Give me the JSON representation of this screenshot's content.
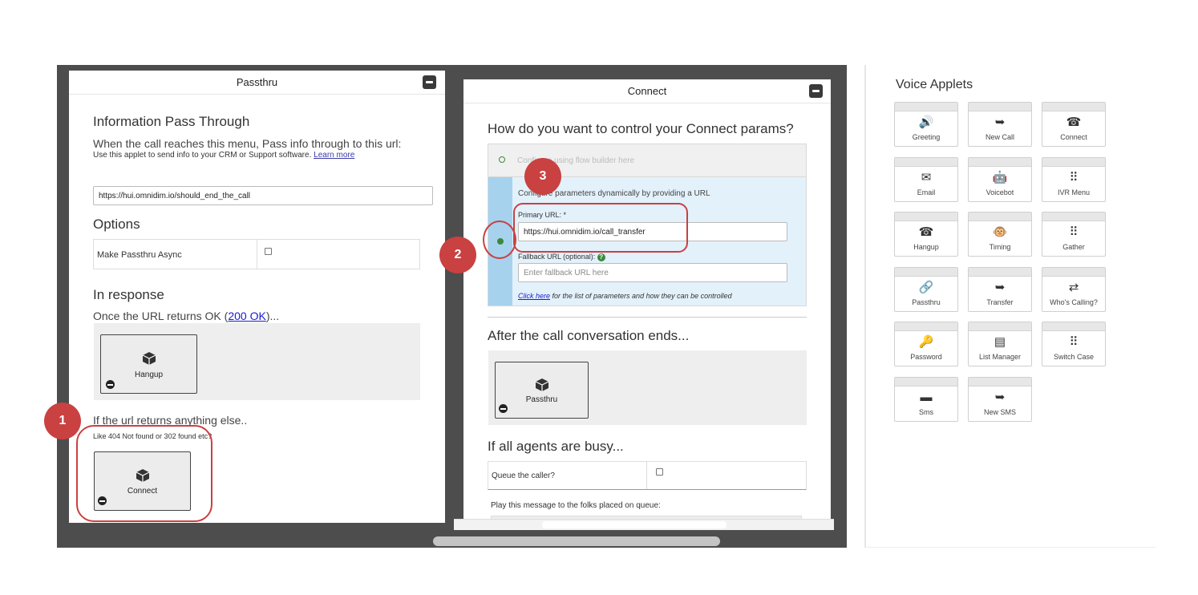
{
  "passthru_panel": {
    "title": "Passthru",
    "section_title": "Information Pass Through",
    "instruction": "When the call reaches this menu, Pass info through to this url:",
    "hint": "Use this applet to send info to your CRM or Support software.",
    "hint_link": "Learn more",
    "url_value": "https://hui.omnidim.io/should_end_the_call",
    "options_title": "Options",
    "async_label": "Make Passthru Async",
    "response_title": "In response",
    "ok_prefix": "Once the URL returns OK (",
    "ok_link": "200 OK",
    "ok_suffix": ")...",
    "ok_applet": "Hangup",
    "else_title": "If the url returns anything else..",
    "else_hint": "Like 404 Not found or 302 found etc?",
    "else_applet": "Connect"
  },
  "connect_panel": {
    "title": "Connect",
    "question": "How do you want to control your Connect params?",
    "option_static": "Configure using flow builder here",
    "option_dynamic": "Configure parameters dynamically by providing a URL",
    "primary_label": "Primary URL: *",
    "primary_value": "https://hui.omnidim.io/call_transfer",
    "fallback_label": "Fallback URL (optional):",
    "fallback_placeholder": "Enter fallback URL here",
    "click_here": "Click here",
    "click_here_suffix": " for the list of parameters and how they can be controlled",
    "after_title": "After the call conversation ends...",
    "after_applet": "Passthru",
    "busy_title": "If all agents are busy...",
    "queue_label": "Queue the caller?",
    "queue_message": "Play this message to the folks placed on queue:"
  },
  "callouts": [
    "1",
    "2",
    "3"
  ],
  "voice_applets": {
    "title": "Voice Applets",
    "items": [
      {
        "label": "Greeting",
        "icon": "greeting-icon",
        "glyph": "🔊"
      },
      {
        "label": "New Call",
        "icon": "new-call-icon",
        "glyph": "➥"
      },
      {
        "label": "Connect",
        "icon": "connect-icon",
        "glyph": "☎"
      },
      {
        "label": "Email",
        "icon": "email-icon",
        "glyph": "✉"
      },
      {
        "label": "Voicebot",
        "icon": "voicebot-icon",
        "glyph": "🤖"
      },
      {
        "label": "IVR Menu",
        "icon": "ivr-menu-icon",
        "glyph": "⠿"
      },
      {
        "label": "Hangup",
        "icon": "hangup-icon",
        "glyph": "☎"
      },
      {
        "label": "Timing",
        "icon": "timing-icon",
        "glyph": "🐵"
      },
      {
        "label": "Gather",
        "icon": "gather-icon",
        "glyph": "⠿"
      },
      {
        "label": "Passthru",
        "icon": "passthru-icon",
        "glyph": "🔗"
      },
      {
        "label": "Transfer",
        "icon": "transfer-icon",
        "glyph": "➥"
      },
      {
        "label": "Who's Calling?",
        "icon": "whos-calling-icon",
        "glyph": "⇄"
      },
      {
        "label": "Password",
        "icon": "password-icon",
        "glyph": "🔑"
      },
      {
        "label": "List Manager",
        "icon": "list-manager-icon",
        "glyph": "▤"
      },
      {
        "label": "Switch Case",
        "icon": "switch-case-icon",
        "glyph": "⠿"
      },
      {
        "label": "Sms",
        "icon": "sms-icon",
        "glyph": "▬"
      },
      {
        "label": "New SMS",
        "icon": "new-sms-icon",
        "glyph": "➥"
      }
    ]
  },
  "colors": {
    "accent_red": "#c94141",
    "radio_green": "#3a8a3a",
    "selected_option_bg": "#e3f1fb"
  }
}
